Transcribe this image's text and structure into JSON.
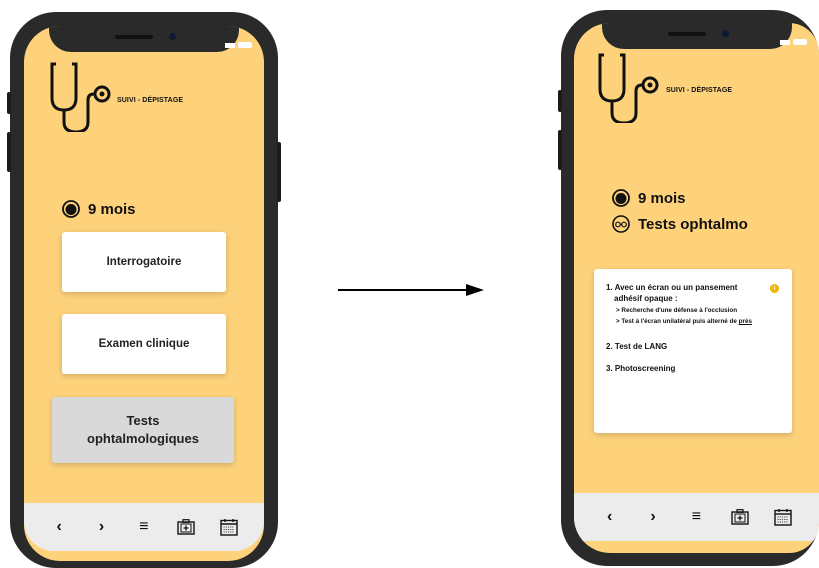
{
  "left_screen": {
    "app_title": "SUIVI - DÉPISTAGE",
    "age_label": "9 mois",
    "buttons": {
      "interrogatoire": "Interrogatoire",
      "examen": "Examen clinique",
      "tests_line1": "Tests",
      "tests_line2": "ophtalmologiques"
    }
  },
  "right_screen": {
    "app_title": "SUIVI - DÉPISTAGE",
    "age_label": "9 mois",
    "tests_label": "Tests ophtalmo",
    "items": {
      "item1_line1": "1. Avec un écran ou un pansement",
      "item1_line2": "adhésif opaque :",
      "sub1": "> Recherche d'une défense à l'occlusion",
      "sub2_prefix": "> Test à l'écran unilatéral puis alterné de ",
      "sub2_link": "près",
      "item2": "2. Test de LANG",
      "item3": "3. Photoscreening",
      "info_symbol": "i"
    }
  },
  "nav": {
    "back": "‹",
    "forward": "›",
    "menu": "≡"
  },
  "icons": [
    "stethoscope-icon",
    "baby-face-icon",
    "glasses-icon",
    "medical-kit-icon",
    "calendar-icon",
    "info-icon",
    "back-arrow-icon",
    "forward-arrow-icon",
    "menu-icon"
  ],
  "colors": {
    "screen_bg": "#fdd27b",
    "info_accent": "#f5b301",
    "selected_button": "#d9d9d9"
  }
}
